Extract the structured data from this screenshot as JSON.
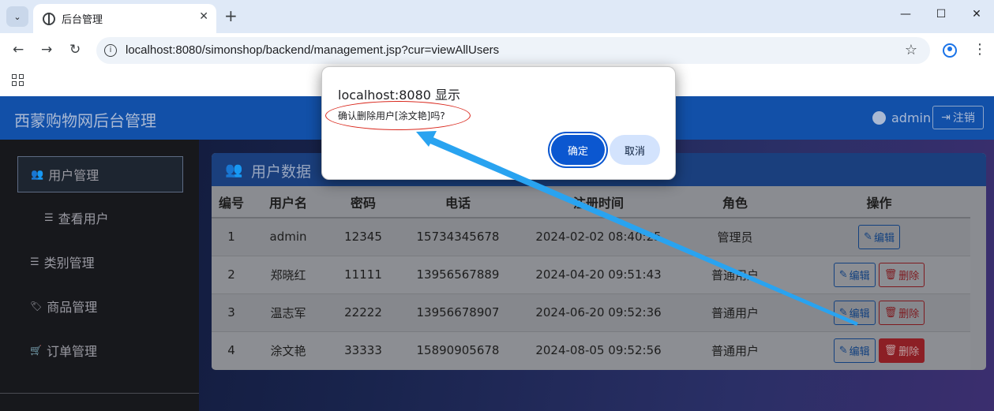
{
  "browser": {
    "tab_title": "后台管理",
    "tab_close": "✕",
    "new_tab": "+",
    "url": "localhost:8080/simonshop/backend/management.jsp?cur=viewAllUsers",
    "window_controls": {
      "minimize": "—",
      "maximize": "☐",
      "close": "✕"
    }
  },
  "header": {
    "brand": "西蒙购物网后台管理",
    "user": "admin",
    "logout_label": "注销"
  },
  "sidebar": {
    "items": [
      {
        "label": "用户管理",
        "icon": "users-icon",
        "glyph": "👥",
        "active": true
      },
      {
        "label": "查看用户",
        "icon": "list-icon",
        "glyph": "☰"
      },
      {
        "label": "类别管理",
        "icon": "list-icon",
        "glyph": "☰"
      },
      {
        "label": "商品管理",
        "icon": "tag-icon",
        "glyph": "🏷"
      },
      {
        "label": "订单管理",
        "icon": "cart-icon",
        "glyph": "🛒"
      }
    ]
  },
  "panel": {
    "title": "用户数据",
    "columns": [
      "编号",
      "用户名",
      "密码",
      "电话",
      "注册时间",
      "角色",
      "操作"
    ],
    "rows": [
      {
        "id": "1",
        "username": "admin",
        "password": "12345",
        "phone": "15734345678",
        "registered": "2024-02-02 08:40:25",
        "role": "管理员",
        "delete": false
      },
      {
        "id": "2",
        "username": "郑晓红",
        "password": "11111",
        "phone": "13956567889",
        "registered": "2024-04-20 09:51:43",
        "role": "普通用户",
        "delete": true
      },
      {
        "id": "3",
        "username": "温志军",
        "password": "22222",
        "phone": "13956678907",
        "registered": "2024-06-20 09:52:36",
        "role": "普通用户",
        "delete": true
      },
      {
        "id": "4",
        "username": "涂文艳",
        "password": "33333",
        "phone": "15890905678",
        "registered": "2024-08-05 09:52:56",
        "role": "普通用户",
        "delete": true
      }
    ],
    "edit_label": "编辑",
    "delete_label": "删除"
  },
  "dialog": {
    "title": "localhost:8080 显示",
    "message": "确认删除用户[涂文艳]吗?",
    "ok_label": "确定",
    "cancel_label": "取消"
  },
  "annotation": {
    "color": "#29a3f0"
  }
}
